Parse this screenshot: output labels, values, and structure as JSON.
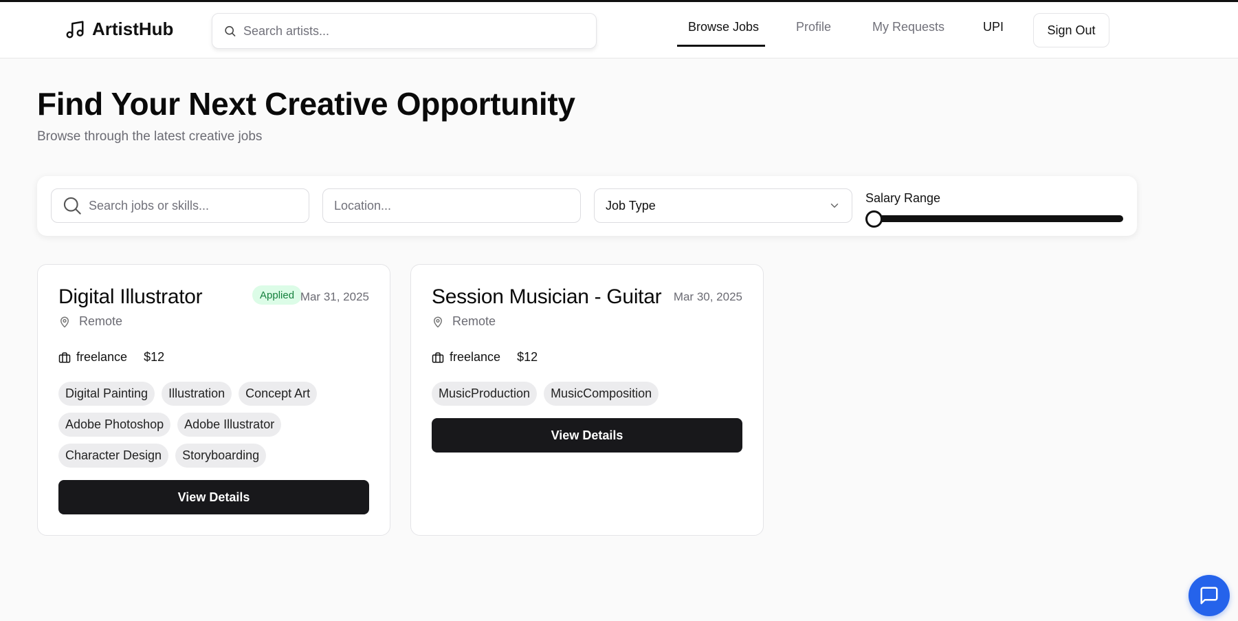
{
  "header": {
    "logo_text": "ArtistHub",
    "search_placeholder": "Search artists...",
    "nav": [
      "Browse Jobs",
      "Profile",
      "My Requests",
      "UPI"
    ],
    "active_nav": "Browse Jobs",
    "sign_out": "Sign Out"
  },
  "page": {
    "title": "Find Your Next Creative Opportunity",
    "subtitle": "Browse through the latest creative jobs"
  },
  "filters": {
    "search_placeholder": "Search jobs or skills...",
    "location_placeholder": "Location...",
    "job_type_value": "Job Type",
    "salary_label": "Salary Range",
    "salary_slider_fraction": 0
  },
  "jobs": [
    {
      "title": "Digital Illustrator",
      "badge": "Applied",
      "date": "Mar 31, 2025",
      "location": "Remote",
      "type": "freelance",
      "pay": "$12",
      "tags": [
        "Digital Painting",
        "Illustration",
        "Concept Art",
        "Adobe Photoshop",
        "Adobe Illustrator",
        "Character Design",
        "Storyboarding"
      ],
      "button": "View Details"
    },
    {
      "title": "Session Musician - Guitar",
      "date": "Mar 30, 2025",
      "location": "Remote",
      "type": "freelance",
      "pay": "$12",
      "tags": [
        "MusicProduction",
        "MusicComposition"
      ],
      "button": "View Details"
    }
  ],
  "colors": {
    "primary": "#18181b",
    "applied_bg": "#dcfce7",
    "applied_text": "#15803d",
    "chat": "#2563eb"
  }
}
